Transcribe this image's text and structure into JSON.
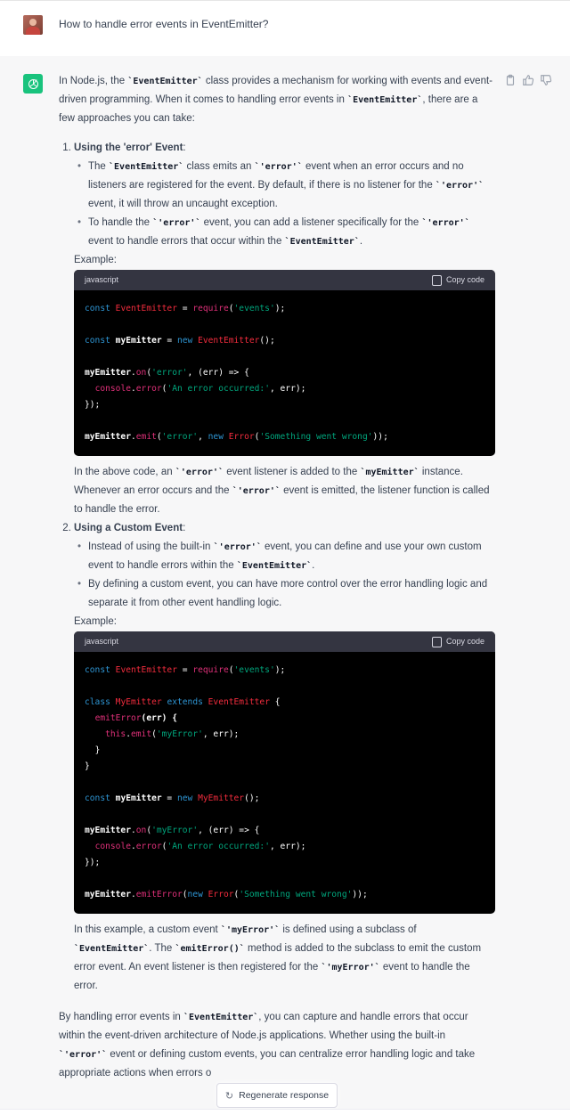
{
  "question": {
    "text": "How to handle error events in EventEmitter?"
  },
  "answer": {
    "intro_a": "In Node.js, the ",
    "intro_code1": "`EventEmitter`",
    "intro_b": " class provides a mechanism for working with events and event-driven programming. When it comes to handling error events in ",
    "intro_code2": "`EventEmitter`",
    "intro_c": ", there are a few approaches you can take:",
    "section1": {
      "title": "Using the 'error' Event",
      "b1_a": "The ",
      "b1_c1": "`EventEmitter`",
      "b1_b": " class emits an ",
      "b1_c2": "`'error'`",
      "b1_c": " event when an error occurs and no listeners are registered for the event. By default, if there is no listener for the ",
      "b1_c3": "`'error'`",
      "b1_d": " event, it will throw an uncaught exception.",
      "b2_a": "To handle the ",
      "b2_c1": "`'error'`",
      "b2_b": " event, you can add a listener specifically for the ",
      "b2_c2": "`'error'`",
      "b2_c": " event to handle errors that occur within the ",
      "b2_c3": "`EventEmitter`",
      "b2_d": ".",
      "example_label": "Example:",
      "code_lang": "javascript",
      "after_a": "In the above code, an ",
      "after_c1": "`'error'`",
      "after_b": " event listener is added to the ",
      "after_c2": "`myEmitter`",
      "after_c": " instance. Whenever an error occurs and the ",
      "after_c3": "`'error'`",
      "after_d": " event is emitted, the listener function is called to handle the error."
    },
    "section2": {
      "title": "Using a Custom Event",
      "b1_a": "Instead of using the built-in ",
      "b1_c1": "`'error'`",
      "b1_b": " event, you can define and use your own custom event to handle errors within the ",
      "b1_c2": "`EventEmitter`",
      "b1_c": ".",
      "b2": "By defining a custom event, you can have more control over the error handling logic and separate it from other event handling logic.",
      "example_label": "Example:",
      "code_lang": "javascript",
      "after_a": "In this example, a custom event ",
      "after_c1": "`'myError'`",
      "after_b": " is defined using a subclass of ",
      "after_c2": "`EventEmitter`",
      "after_c": ". The ",
      "after_c3": "`emitError()`",
      "after_d": " method is added to the subclass to emit the custom error event. An event listener is then registered for the ",
      "after_c4": "`'myError'`",
      "after_e": " event to handle the error."
    },
    "outro_a": "By handling error events in ",
    "outro_c1": "`EventEmitter`",
    "outro_b": ", you can capture and handle errors that occur within the event-driven architecture of Node.js applications. Whether using the built-in ",
    "outro_c2": "`'error'`",
    "outro_c": " event or defining custom events, you can centralize error handling logic and take appropriate actions when errors o"
  },
  "code": {
    "copy_label": "Copy code",
    "s1": {
      "l1_kw": "const",
      "l1_cls": "EventEmitter",
      "l1_eq": " = ",
      "l1_fn": "require",
      "l1_str": "'events'",
      "l1_end": ");",
      "l2_kw": "const",
      "l2_id": "myEmitter",
      "l2_eq": " = ",
      "l2_new": "new",
      "l2_cls": "EventEmitter",
      "l2_end": "();",
      "l3_id": "myEmitter",
      "l3_dot": ".",
      "l3_fn": "on",
      "l3_str": "'error'",
      "l3_rest": ", (err) => {",
      "l4_id": "console",
      "l4_dot": ".",
      "l4_fn": "error",
      "l4_str": "'An error occurred:'",
      "l4_rest": ", err);",
      "l5": "});",
      "l6_id": "myEmitter",
      "l6_dot": ".",
      "l6_fn": "emit",
      "l6_str": "'error'",
      "l6_new": "new",
      "l6_cls": "Error",
      "l6_str2": "'Something went wrong'",
      "l6_end": "));"
    },
    "s2": {
      "l1_kw": "const",
      "l1_cls": "EventEmitter",
      "l1_eq": " = ",
      "l1_fn": "require",
      "l1_str": "'events'",
      "l1_end": ");",
      "l2_kw": "class",
      "l2_cls": "MyEmitter",
      "l2_ext": "extends",
      "l2_cls2": "EventEmitter",
      "l2_end": " {",
      "l3_fn": "emitError",
      "l3_rest": "(err) {",
      "l4_kw": "this",
      "l4_dot": ".",
      "l4_fn": "emit",
      "l4_str": "'myError'",
      "l4_rest": ", err);",
      "l5": "}",
      "l6": "}",
      "l7_kw": "const",
      "l7_id": "myEmitter",
      "l7_eq": " = ",
      "l7_new": "new",
      "l7_cls": "MyEmitter",
      "l7_end": "();",
      "l8_id": "myEmitter",
      "l8_dot": ".",
      "l8_fn": "on",
      "l8_str": "'myError'",
      "l8_rest": ", (err) => {",
      "l9_id": "console",
      "l9_dot": ".",
      "l9_fn": "error",
      "l9_str": "'An error occurred:'",
      "l9_rest": ", err);",
      "l10": "});",
      "l11_id": "myEmitter",
      "l11_dot": ".",
      "l11_fn": "emitError",
      "l11_new": "new",
      "l11_cls": "Error",
      "l11_str": "'Something went wrong'",
      "l11_end": "));"
    }
  },
  "regenerate": {
    "label": "Regenerate response"
  }
}
